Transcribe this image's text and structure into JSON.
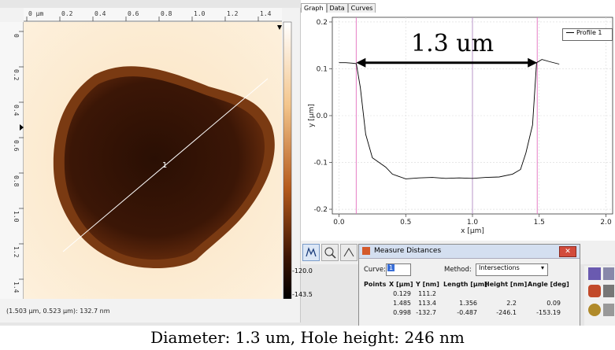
{
  "afm": {
    "x_ticks": [
      "0 µm",
      "0.2",
      "0.4",
      "0.6",
      "0.8",
      "1.0",
      "1.2",
      "1.4"
    ],
    "y_ticks": [
      "0",
      "0.2",
      "0.4",
      "0.6",
      "0.8",
      "1.0",
      "1.2",
      "1.4"
    ],
    "profile_marker": "1",
    "colorbar_min_labels": [
      "-120.0",
      "-143.5"
    ],
    "status": "(1.503 µm, 0.523 µm): 132.7 nm"
  },
  "graph": {
    "tabs": [
      "Graph",
      "Data",
      "Curves"
    ],
    "active_tab": "Graph",
    "legend_label": "Profile 1",
    "annotation": "1.3 um"
  },
  "dialog": {
    "title": "Measure Distances",
    "curve_label": "Curve:",
    "curve_value": "1",
    "method_label": "Method:",
    "method_value": "Intersections",
    "columns": [
      "Points",
      "X [µm]",
      "Y [nm]",
      "Length [µm]",
      "Height [nm]",
      "Angle [deg]"
    ],
    "rows": [
      [
        "",
        "0.129",
        "111.2",
        "",
        "",
        ""
      ],
      [
        "",
        "1.485",
        "113.4",
        "1.356",
        "2.2",
        "0.09"
      ],
      [
        "",
        "0.998",
        "-132.7",
        "-0.487",
        "-246.1",
        "-153.19"
      ]
    ]
  },
  "caption": "Diameter: 1.3 um, Hole height: 246 nm",
  "chart_data": {
    "type": "line",
    "series": [
      {
        "name": "Profile 1",
        "x": [
          0.0,
          0.05,
          0.1,
          0.13,
          0.16,
          0.2,
          0.25,
          0.3,
          0.35,
          0.4,
          0.45,
          0.5,
          0.6,
          0.7,
          0.8,
          0.9,
          1.0,
          1.1,
          1.2,
          1.3,
          1.36,
          1.4,
          1.45,
          1.48,
          1.52,
          1.58,
          1.65
        ],
        "y": [
          0.113,
          0.113,
          0.112,
          0.111,
          0.06,
          -0.04,
          -0.09,
          -0.1,
          -0.11,
          -0.125,
          -0.13,
          -0.135,
          -0.133,
          -0.132,
          -0.134,
          -0.133,
          -0.134,
          -0.132,
          -0.131,
          -0.125,
          -0.115,
          -0.08,
          -0.02,
          0.113,
          0.12,
          0.115,
          0.11
        ]
      }
    ],
    "xlabel": "x [µm]",
    "ylabel": "y [µm]",
    "x_ticks": [
      "0.0",
      "0.5",
      "1.0",
      "1.5",
      "2.0"
    ],
    "y_ticks": [
      "0.2",
      "0.1",
      "0.0",
      "-0.1",
      "-0.2"
    ],
    "xlim": [
      -0.05,
      2.05
    ],
    "ylim": [
      -0.21,
      0.21
    ],
    "markers_x": [
      0.129,
      1.485,
      1.0
    ],
    "grid": true
  }
}
